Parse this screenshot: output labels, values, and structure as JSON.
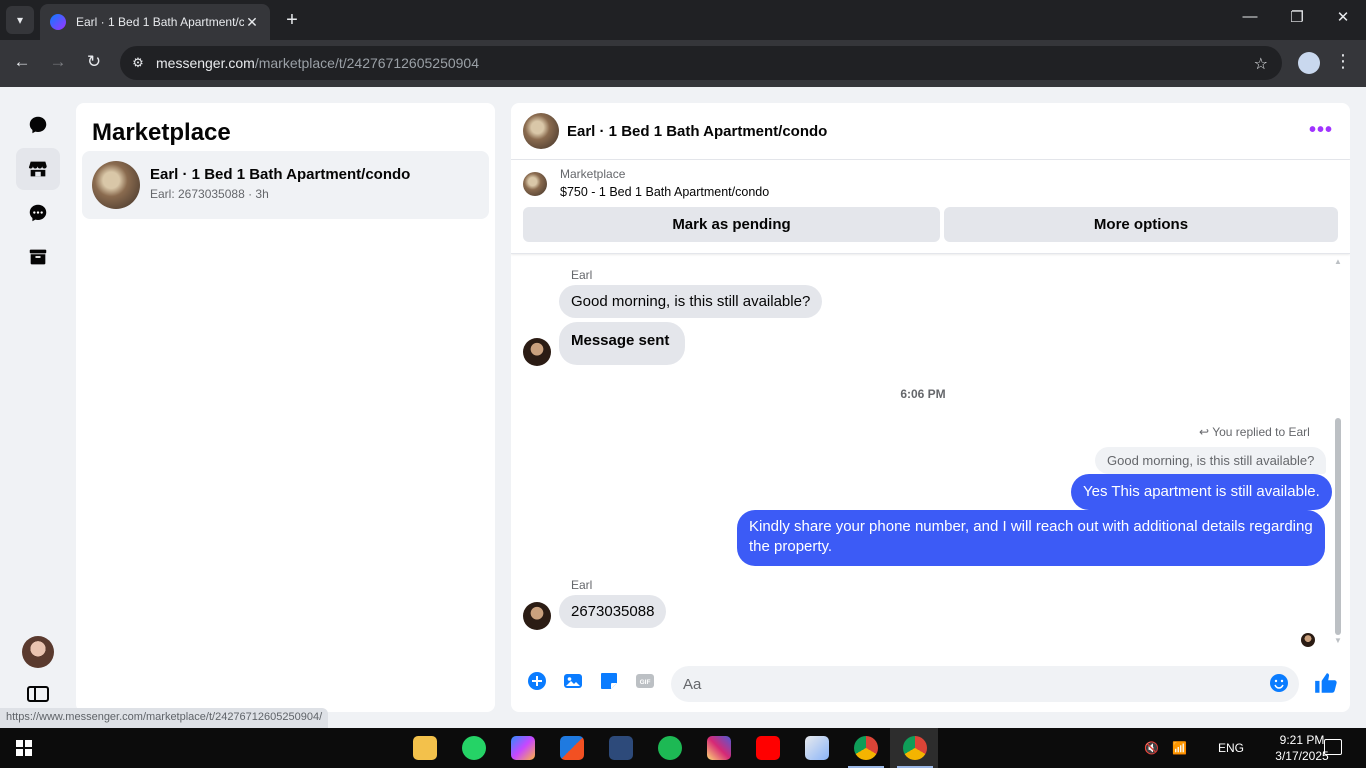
{
  "browser": {
    "tab_title": "Earl · 1 Bed 1 Bath Apartment/condo",
    "url_domain": "messenger.com",
    "url_path": "/marketplace/t/24276712605250904",
    "status_link": "https://www.messenger.com/marketplace/t/24276712605250904/"
  },
  "sidebar": {
    "title": "Marketplace",
    "conversations": [
      {
        "name": "Earl · 1 Bed 1 Bath Apartment/condo",
        "subtitle": "Earl: 2673035088 · 3h"
      }
    ]
  },
  "chat": {
    "header_title": "Earl · 1 Bed 1 Bath Apartment/condo",
    "listing_source": "Marketplace",
    "listing_title": "$750 - 1 Bed 1 Bath Apartment/condo",
    "buttons": {
      "mark_pending": "Mark as pending",
      "more_options": "More options"
    },
    "messages": {
      "sender_1": "Earl",
      "msg_1": "Good morning, is this still available?",
      "msg_2": "Message sent",
      "timestamp": "6:06 PM",
      "replied_label": "You replied to Earl",
      "quoted": "Good morning, is this still available?",
      "reply_1": "Yes This apartment is still available.",
      "reply_2": "Kindly share your phone number, and I will reach out with additional details regarding the property.",
      "sender_2": "Earl",
      "msg_3": "2673035088"
    },
    "composer_placeholder": "Aa"
  },
  "taskbar": {
    "language": "ENG",
    "time": "9:21 PM",
    "date": "3/17/2025"
  },
  "colors": {
    "accent": "#0a7cff",
    "outgoing_bubble": "#3c5bf6",
    "more_icon": "#a033ff"
  }
}
